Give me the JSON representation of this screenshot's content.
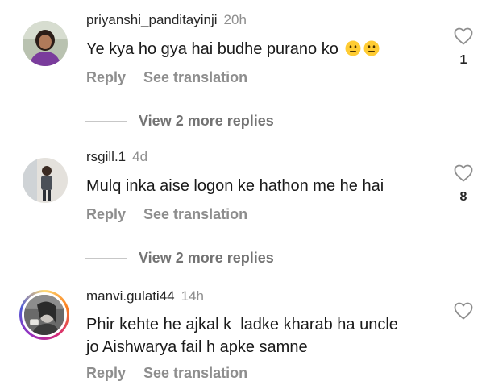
{
  "comments": [
    {
      "username": "priyanshi_panditayinji",
      "time": "20h",
      "text": "Ye kya ho gya hai budhe purano ko",
      "emoji": "😐😐",
      "reply_label": "Reply",
      "translate_label": "See translation",
      "like_count": "1"
    },
    {
      "username": "rsgill.1",
      "time": "4d",
      "text": "Mulq inka aise logon ke hathon me he hai",
      "reply_label": "Reply",
      "translate_label": "See translation",
      "like_count": "8"
    },
    {
      "username": "manvi.gulati44",
      "time": "14h",
      "text_line1": "Phir kehte he ajkal k  ladke kharab ha uncle",
      "text_line2": "jo Aishwarya fail h apke samne",
      "reply_label": "Reply",
      "translate_label": "See translation",
      "like_count": ""
    }
  ],
  "view_replies": [
    {
      "label": "View 2 more replies"
    },
    {
      "label": "View 2 more replies"
    }
  ],
  "colors": {
    "username": "#262626",
    "secondary": "#8e8e8e",
    "story_ring": "#d62976"
  }
}
